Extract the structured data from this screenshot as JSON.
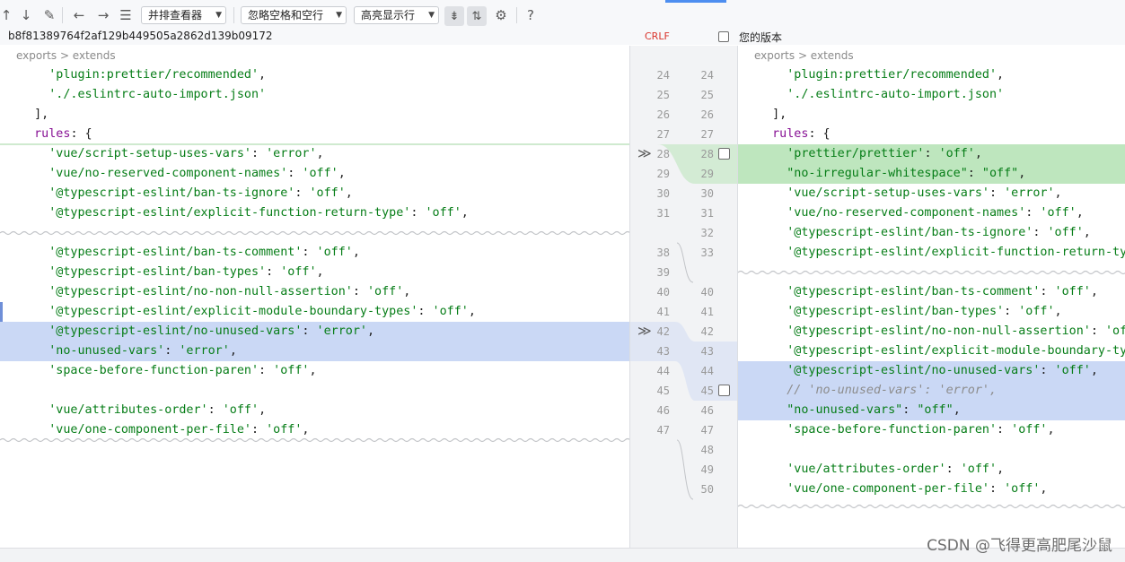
{
  "toolbar": {
    "icons": [
      "up-arrow-icon",
      "down-arrow-icon",
      "edit-pencil-icon",
      "back-arrow-icon",
      "forward-arrow-icon",
      "list-icon",
      "collapse-icon",
      "sync-scroll-icon",
      "gear-icon",
      "help-icon"
    ],
    "viewer_select": "并排查看器",
    "whitespace_select": "忽略空格和空行",
    "highlight_select": "高亮显示行",
    "help_glyph": "?"
  },
  "info": {
    "revision_hash": "b8f81389764f2af129b449505a2862d139b09172",
    "line_separator": "CRLF",
    "yours_label": "您的版本"
  },
  "left": {
    "breadcrumb": "exports > extends",
    "lines": [
      "    'plugin:prettier/recommended',",
      "    './.eslintrc-auto-import.json'",
      "  ],",
      "  rules: {",
      "    'vue/script-setup-uses-vars': 'error',",
      "    'vue/no-reserved-component-names': 'off',",
      "    '@typescript-eslint/ban-ts-ignore': 'off',",
      "    '@typescript-eslint/explicit-function-return-type': 'off',",
      "    '@typescript-eslint/ban-ts-comment': 'off',",
      "    '@typescript-eslint/ban-types': 'off',",
      "    '@typescript-eslint/no-non-null-assertion': 'off',",
      "    '@typescript-eslint/explicit-module-boundary-types': 'off',",
      "    '@typescript-eslint/no-unused-vars': 'error',",
      "    'no-unused-vars': 'error',",
      "    'space-before-function-paren': 'off',",
      "",
      "    'vue/attributes-order': 'off',",
      "    'vue/one-component-per-file': 'off',"
    ]
  },
  "right": {
    "breadcrumb": "exports > extends",
    "lines": [
      "    'plugin:prettier/recommended',",
      "    './.eslintrc-auto-import.json'",
      "  ],",
      "  rules: {",
      "    'prettier/prettier': 'off',",
      "    \"no-irregular-whitespace\": \"off\",",
      "    'vue/script-setup-uses-vars': 'error',",
      "    'vue/no-reserved-component-names': 'off',",
      "    '@typescript-eslint/ban-ts-ignore': 'off',",
      "    '@typescript-eslint/explicit-function-return-type': 'off',",
      "    '@typescript-eslint/ban-ts-comment': 'off',",
      "    '@typescript-eslint/ban-types': 'off',",
      "    '@typescript-eslint/no-non-null-assertion': 'off',",
      "    '@typescript-eslint/explicit-module-boundary-types': 'off',",
      "    '@typescript-eslint/no-unused-vars': 'off',",
      "    // 'no-unused-vars': 'error',",
      "    \"no-unused-vars\": \"off\",",
      "    'space-before-function-paren': 'off',",
      "",
      "    'vue/attributes-order': 'off',",
      "    'vue/one-component-per-file': 'off',"
    ]
  },
  "gutter": {
    "left_numbers": [
      "24",
      "25",
      "26",
      "27",
      "28",
      "29",
      "30",
      "31",
      "38",
      "39",
      "40",
      "41",
      "42",
      "43",
      "44",
      "45",
      "46",
      "47"
    ],
    "right_numbers": [
      "24",
      "25",
      "26",
      "27",
      "28",
      "29",
      "30",
      "31",
      "32",
      "33",
      "40",
      "41",
      "42",
      "43",
      "44",
      "45",
      "46",
      "47",
      "48",
      "49",
      "50"
    ],
    "apply_glyph": "≫"
  },
  "colors": {
    "added_bg": "#bee6be",
    "modified_bg": "#cad8f5",
    "string": "#067d17",
    "keyword": "#871094",
    "crlf": "#d9342b"
  },
  "watermark": "CSDN @飞得更高肥尾沙鼠"
}
